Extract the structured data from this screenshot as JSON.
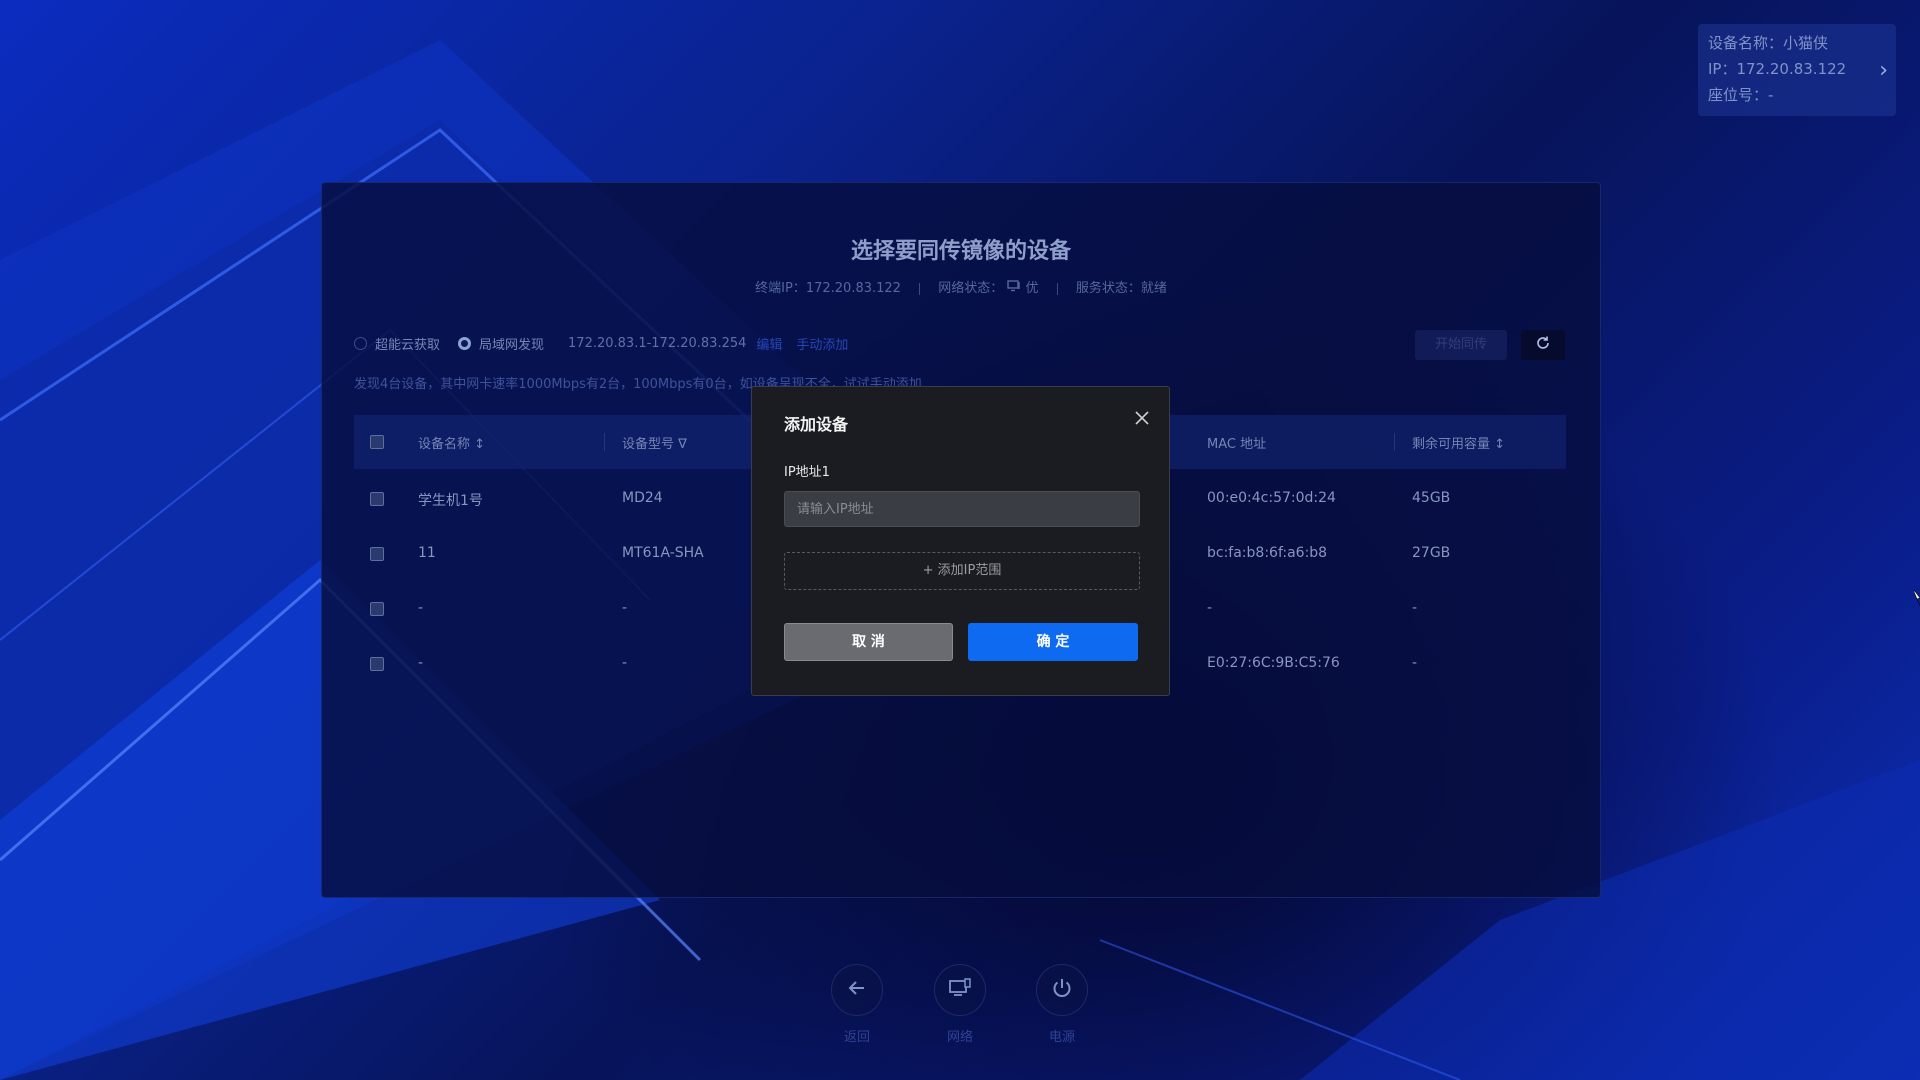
{
  "panel": {
    "title": "选择要同传镜像的设备",
    "terminal_ip": "终端IP：172.20.83.122",
    "network_status": "网络状态：",
    "network_value": "优",
    "service_status": "服务状态：就绪",
    "mode_cloud": "超能云获取",
    "mode_lan": "局域网发现",
    "ip_range": "172.20.83.1-172.20.83.254",
    "edit_link": "编辑",
    "manual_add_link": "手动添加",
    "start_button": "开始同传",
    "found_text": "发现4台设备，其中网卡速率1000Mbps有2台，100Mbps有0台，如设备呈现不全，试试手动添加"
  },
  "table": {
    "headers": {
      "name": "设备名称 ↕",
      "model": "设备型号 ∇",
      "mac": "MAC 地址",
      "capacity": "剩余可用容量 ↕"
    },
    "rows": [
      {
        "name": "学生机1号",
        "model": "MD24",
        "mac": "00:e0:4c:57:0d:24",
        "capacity": "45GB"
      },
      {
        "name": "11",
        "model": "MT61A-SHA",
        "mac": "bc:fa:b8:6f:a6:b8",
        "capacity": "27GB"
      },
      {
        "name": "-",
        "model": "-",
        "mac": "-",
        "capacity": "-"
      },
      {
        "name": "-",
        "model": "-",
        "mac": "E0:27:6C:9B:C5:76",
        "capacity": "-"
      }
    ]
  },
  "modal": {
    "title": "添加设备",
    "field_label": "IP地址1",
    "field_placeholder": "请输入IP地址",
    "field_value": "",
    "add_range": "+ 添加IP范围",
    "cancel": "取 消",
    "ok": "确 定"
  },
  "device_info": {
    "name": "设备名称：小猫侠",
    "ip": "IP：172.20.83.122",
    "seat": "座位号：-"
  },
  "bottom_bar": {
    "back": "返回",
    "network": "网络",
    "power": "电源"
  },
  "colors": {
    "accent": "#0f6af2",
    "link": "#2747b6",
    "background": "#0a238f"
  },
  "icons": [
    "refresh-icon",
    "close-icon",
    "chevron-right-icon",
    "arrow-left-icon",
    "network-icon",
    "power-icon",
    "sort-icon",
    "filter-icon"
  ]
}
